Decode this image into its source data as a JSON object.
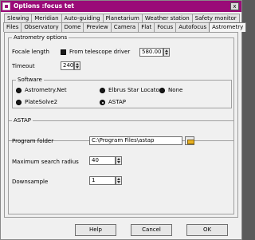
{
  "window": {
    "title": "Options :focus tet",
    "close_glyph": "x",
    "accent": "#9a0a78"
  },
  "tabs_row1": [
    {
      "label": "Slewing"
    },
    {
      "label": "Meridian"
    },
    {
      "label": "Auto-guiding"
    },
    {
      "label": "Planetarium"
    },
    {
      "label": "Weather station"
    },
    {
      "label": "Safety monitor"
    }
  ],
  "tabs_row2": [
    {
      "label": "Files"
    },
    {
      "label": "Observatory"
    },
    {
      "label": "Dome"
    },
    {
      "label": "Preview"
    },
    {
      "label": "Camera"
    },
    {
      "label": "Flat"
    },
    {
      "label": "Focus"
    },
    {
      "label": "Autofocus"
    },
    {
      "label": "Astrometry",
      "active": true
    }
  ],
  "astrometry_options": {
    "title": "Astrometry options",
    "focale_label": "Focale length",
    "from_telescope_label": "From telescope driver",
    "focale_value": "580.00",
    "timeout_label": "Timeout",
    "timeout_value": "240"
  },
  "software": {
    "title": "Software",
    "options": [
      {
        "label": "Astrometry.Net",
        "checked": false
      },
      {
        "label": "Elbrus Star Locator",
        "checked": false
      },
      {
        "label": "None",
        "checked": false
      },
      {
        "label": "PlateSolve2",
        "checked": false
      },
      {
        "label": "ASTAP",
        "checked": true
      }
    ]
  },
  "astap": {
    "title": "ASTAP",
    "program_folder_label": "Program folder",
    "program_folder_value": "C:\\Program Files\\astap",
    "max_radius_label": "Maximum search radius",
    "max_radius_value": "40",
    "downsample_label": "Downsample",
    "downsample_value": "1"
  },
  "buttons": {
    "help": "Help",
    "cancel": "Cancel",
    "ok": "OK"
  }
}
